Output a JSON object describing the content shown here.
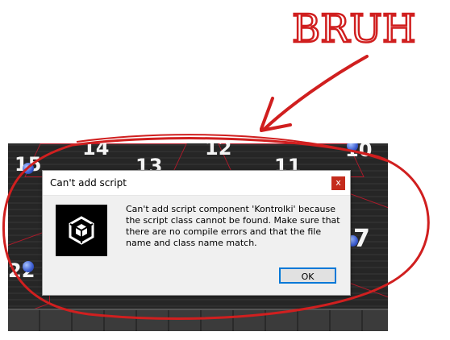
{
  "annotation": {
    "text": "BRUH",
    "color": "#d01f1f"
  },
  "game": {
    "numbers": [
      "14",
      "12",
      "10",
      "15",
      "13",
      "11",
      "7",
      "22"
    ]
  },
  "dialog": {
    "title": "Can't add script",
    "close_label": "x",
    "message": "Can't add script component 'Kontrolki' because the script class cannot be found. Make sure that there are no compile errors and that the file name and class name match.",
    "ok_label": "OK",
    "icon": "unity-logo-icon"
  }
}
